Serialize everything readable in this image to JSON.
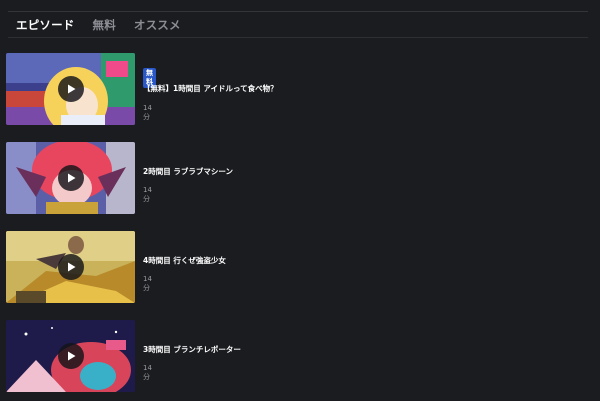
{
  "tabs": [
    {
      "label": "エピソード",
      "active": true
    },
    {
      "label": "無料",
      "active": false
    },
    {
      "label": "オススメ",
      "active": false
    }
  ],
  "episodes": [
    {
      "badge": "無料",
      "title": "【無料】1時間目 アイドルって食べ物？",
      "duration": "14分"
    },
    {
      "badge": "",
      "title": "2時間目 ラブラブマシーン",
      "duration": "14分"
    },
    {
      "badge": "",
      "title": "4時間目 行くぜ強盗少女",
      "duration": "14分"
    },
    {
      "badge": "",
      "title": "3時間目 ブランチレポーター",
      "duration": "14分"
    }
  ],
  "colors": {
    "background": "#1b1c20",
    "badge": "#2a57c8",
    "muted_text": "#9a9ba2"
  },
  "icons": {
    "play": "play-icon"
  }
}
